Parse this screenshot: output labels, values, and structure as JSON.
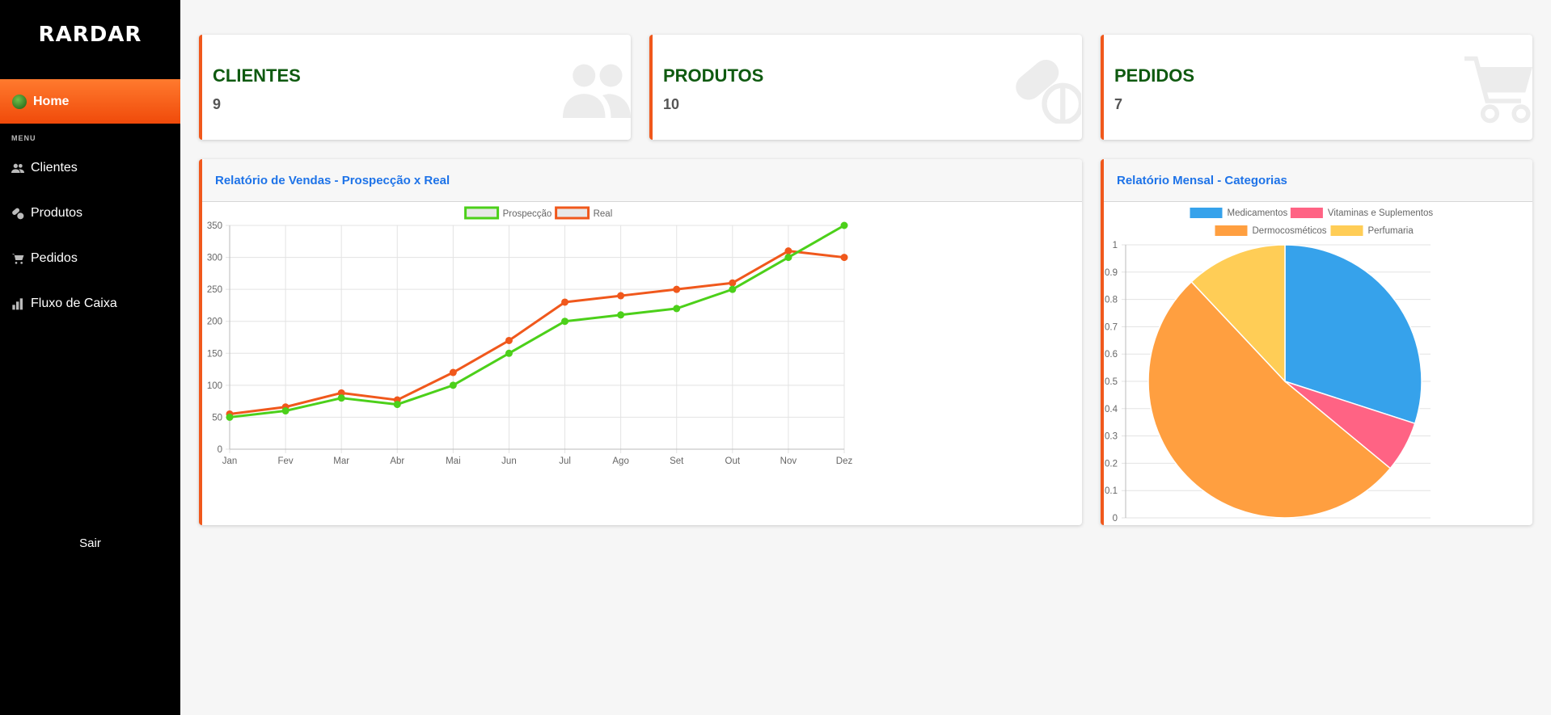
{
  "sidebar": {
    "logo": "RARDAR",
    "home_label": "Home",
    "menu_label": "MENU",
    "items": [
      {
        "label": "Clientes",
        "icon": "users-icon"
      },
      {
        "label": "Produtos",
        "icon": "pills-icon"
      },
      {
        "label": "Pedidos",
        "icon": "cart-icon"
      },
      {
        "label": "Fluxo de Caixa",
        "icon": "bar-chart-icon"
      }
    ],
    "logout_label": "Sair"
  },
  "stats": [
    {
      "title": "CLIENTES",
      "value": "9",
      "icon": "users-icon"
    },
    {
      "title": "PRODUTOS",
      "value": "10",
      "icon": "pills-icon"
    },
    {
      "title": "PEDIDOS",
      "value": "7",
      "icon": "cart-icon"
    }
  ],
  "panels": {
    "sales_title": "Relatório de Vendas - Prospecção x Real",
    "monthly_title": "Relatório Mensal - Categorias"
  },
  "colors": {
    "accent": "#f0581c",
    "stat_title": "#0f5a10",
    "panel_title": "#1e73e8"
  },
  "chart_data": [
    {
      "type": "line",
      "title": "Relatório de Vendas - Prospecção x Real",
      "categories": [
        "Jan",
        "Fev",
        "Mar",
        "Abr",
        "Mai",
        "Jun",
        "Jul",
        "Ago",
        "Set",
        "Out",
        "Nov",
        "Dez"
      ],
      "series": [
        {
          "name": "Prospecção",
          "color": "#4cd01a",
          "values": [
            50,
            60,
            80,
            70,
            100,
            150,
            200,
            210,
            220,
            250,
            300,
            350
          ]
        },
        {
          "name": "Real",
          "color": "#f0581c",
          "values": [
            55,
            66,
            88,
            77,
            120,
            170,
            230,
            240,
            250,
            260,
            310,
            300
          ]
        }
      ],
      "ylim": [
        0,
        350
      ],
      "yticks": [
        0,
        50,
        100,
        150,
        200,
        250,
        300,
        350
      ],
      "grid": true,
      "legend": "top"
    },
    {
      "type": "pie",
      "title": "Relatório Mensal - Categorias",
      "labels": [
        "Medicamentos",
        "Vitaminas e Suplementos",
        "Dermocosméticos",
        "Perfumaria"
      ],
      "colors": [
        "#36a2eb",
        "#ff6384",
        "#ff9f40",
        "#ffcd56"
      ],
      "values": [
        30,
        6,
        52,
        12
      ],
      "ylim": [
        0,
        1
      ],
      "yticks": [
        "0",
        "0.1",
        "0.2",
        "0.3",
        "0.4",
        "0.5",
        "0.6",
        "0.7",
        "0.8",
        "0.9",
        "1"
      ],
      "grid": true,
      "legend": "top"
    }
  ]
}
